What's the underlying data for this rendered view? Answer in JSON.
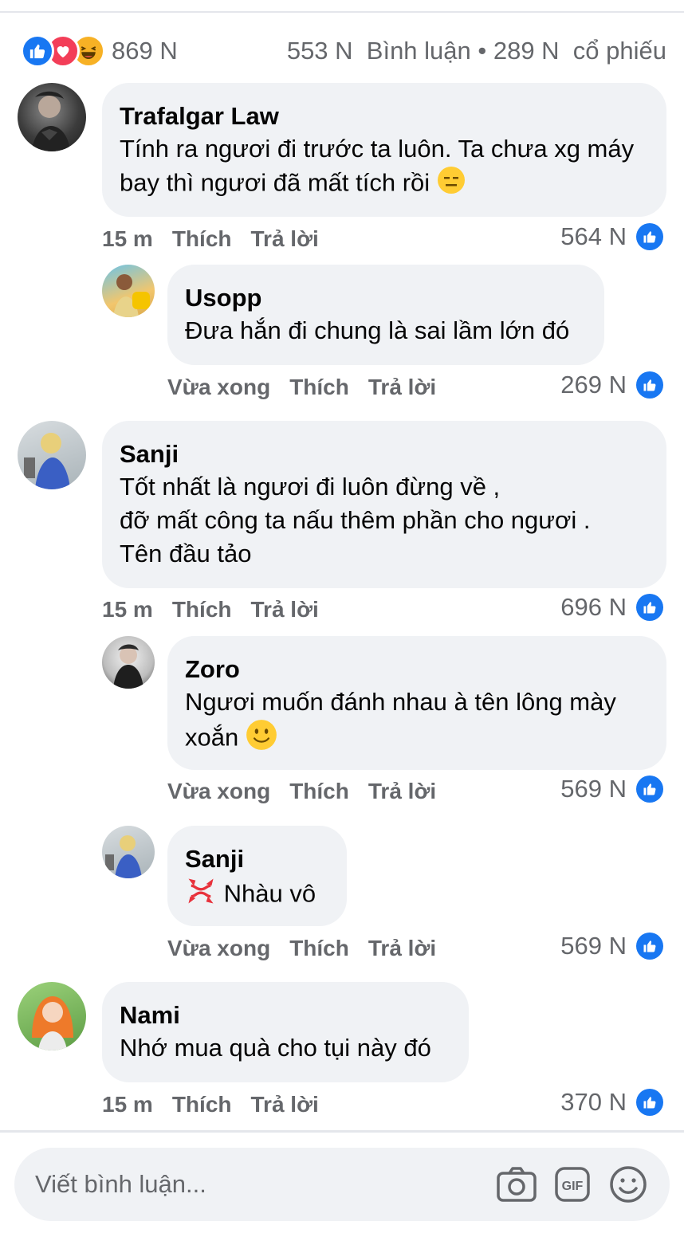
{
  "reactions": {
    "icons": [
      "like-icon",
      "love-icon",
      "haha-icon"
    ],
    "total": "869 N",
    "comments_shares": "553 N  Bình luận • 289 N  cổ phiếu"
  },
  "comments": [
    {
      "author": "Trafalgar Law",
      "lines": [
        "Tính ra ngươi đi trước ta luôn. Ta chưa xg máy",
        "bay thì ngươi đã mất tích rồi"
      ],
      "emoji": "😑",
      "time": "15 m",
      "like_label": "Thích",
      "reply_label": "Trả lời",
      "like_count": "564 N"
    },
    {
      "author": "Usopp",
      "lines": [
        "Đưa hắn đi chung là sai lầm lớn đó"
      ],
      "time": "Vừa xong",
      "like_label": "Thích",
      "reply_label": "Trả lời",
      "like_count": "269 N"
    },
    {
      "author": "Sanji",
      "lines": [
        "Tốt nhất là ngươi đi luôn đừng về ,",
        "đỡ mất công ta nấu thêm phần cho ngươi .",
        "Tên đầu tảo"
      ],
      "time": "15 m",
      "like_label": "Thích",
      "reply_label": "Trả lời",
      "like_count": "696 N"
    },
    {
      "author": "Zoro",
      "lines": [
        "Ngươi muốn đánh nhau à tên lông mày",
        "xoắn"
      ],
      "emoji": "🙂",
      "time": "Vừa xong",
      "like_label": "Thích",
      "reply_label": "Trả lời",
      "like_count": "569 N"
    },
    {
      "author": "Sanji",
      "lines": [
        "Nhàu vô"
      ],
      "emoji": "💢",
      "time": "Vừa xong",
      "like_label": "Thích",
      "reply_label": "Trả lời",
      "like_count": "569 N"
    },
    {
      "author": "Nami",
      "lines": [
        "Nhớ mua quà cho tụi này đó"
      ],
      "time": "15 m",
      "like_label": "Thích",
      "reply_label": "Trả lời",
      "like_count": "370 N"
    }
  ],
  "composer": {
    "placeholder": "Viết bình luận...",
    "icons": [
      "camera-icon",
      "gif-icon",
      "emoji-icon"
    ]
  },
  "colors": {
    "accent": "#1877f2",
    "bubble": "#f0f2f5",
    "secondary_text": "#65676b"
  }
}
